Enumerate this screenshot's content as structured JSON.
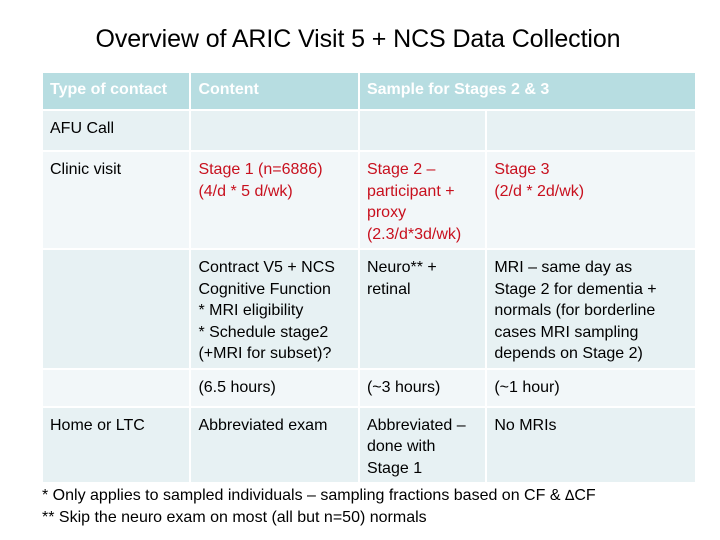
{
  "title": "Overview of ARIC Visit 5 + NCS Data Collection",
  "table": {
    "headers": {
      "type_of_contact": "Type of contact",
      "content": "Content",
      "sample": "Sample for Stages 2 & 3"
    },
    "rows": {
      "afu": {
        "type": "AFU Call",
        "content": "",
        "stage2": "",
        "stage3": ""
      },
      "clinic": {
        "type": "Clinic visit",
        "stage1_line1": "Stage 1 (n=6886)",
        "stage1_line2": "(4/d * 5 d/wk)",
        "stage2_line1": "Stage 2 –",
        "stage2_line2": "participant +",
        "stage2_line3": "proxy",
        "stage2_line4": "(2.3/d*3d/wk)",
        "stage3_line1": "Stage 3",
        "stage3_line2": "(2/d * 2d/wk)"
      },
      "contract": {
        "type": "",
        "content_line1": "Contract V5 + NCS",
        "content_line2": "Cognitive Function",
        "content_line3": "* MRI eligibility",
        "content_line4": "* Schedule stage2",
        "content_line5": "(+MRI for subset)?",
        "stage2_line1": "Neuro** +",
        "stage2_line2": "retinal",
        "stage3_line1": "MRI – same day as",
        "stage3_line2": "Stage 2 for dementia +",
        "stage3_line3": "normals (for borderline",
        "stage3_line4": "cases MRI sampling",
        "stage3_line5": "depends on Stage 2)"
      },
      "hours": {
        "type": "",
        "content": "(6.5 hours)",
        "stage2": "(~3 hours)",
        "stage3": "(~1 hour)"
      },
      "home": {
        "type": "Home or LTC",
        "content": "Abbreviated exam",
        "stage2_line1": "Abbreviated –",
        "stage2_line2": "done with",
        "stage2_line3": "Stage 1",
        "stage3": "No MRIs"
      }
    }
  },
  "footnotes": {
    "note1_prefix": "* Only applies to sampled individuals – sampling fractions based on CF & ",
    "note1_delta": "∆",
    "note1_suffix": "CF",
    "note2": "** Skip the neuro exam on most (all but n=50) normals"
  },
  "colors": {
    "header_bg": "#b7dde1",
    "row_dark": "#e7f1f3",
    "row_light": "#f2f7f9",
    "highlight_text": "#c8101e"
  }
}
